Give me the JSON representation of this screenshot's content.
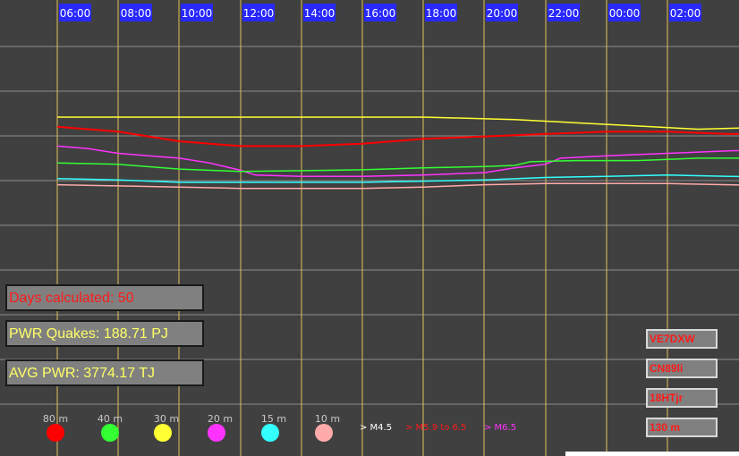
{
  "chart_data": {
    "type": "line",
    "x_ticks": [
      "06:00",
      "08:00",
      "10:00",
      "12:00",
      "14:00",
      "16:00",
      "18:00",
      "20:00",
      "22:00",
      "00:00",
      "02:00"
    ],
    "grid": true,
    "series": [
      {
        "name": "80 m",
        "color": "#ffff33",
        "values": [
          [
            0,
            3
          ],
          [
            3,
            3
          ],
          [
            6,
            3
          ],
          [
            9,
            3
          ],
          [
            12,
            3
          ],
          [
            15,
            2.9
          ],
          [
            18,
            2.7
          ],
          [
            19.5,
            2.6
          ],
          [
            21,
            2.5
          ],
          [
            24,
            2.6
          ]
        ]
      },
      {
        "name": "80 m",
        "color": "#ff0000",
        "values": [
          [
            0,
            2.6
          ],
          [
            2,
            2.4
          ],
          [
            4,
            2.0
          ],
          [
            6,
            1.8
          ],
          [
            8,
            1.8
          ],
          [
            10,
            1.9
          ],
          [
            12,
            2.1
          ],
          [
            14,
            2.2
          ],
          [
            16,
            2.3
          ],
          [
            18,
            2.4
          ],
          [
            20,
            2.4
          ],
          [
            22,
            2.3
          ],
          [
            24,
            2.3
          ]
        ]
      },
      {
        "name": "20 m",
        "color": "#ff33ff",
        "values": [
          [
            0,
            1.8
          ],
          [
            1,
            1.7
          ],
          [
            2,
            1.5
          ],
          [
            3,
            1.4
          ],
          [
            4,
            1.3
          ],
          [
            5,
            1.1
          ],
          [
            6,
            0.8
          ],
          [
            6.5,
            0.6
          ],
          [
            8,
            0.55
          ],
          [
            10,
            0.55
          ],
          [
            12,
            0.6
          ],
          [
            14,
            0.7
          ],
          [
            15,
            0.9
          ],
          [
            16,
            1.05
          ],
          [
            16.5,
            1.3
          ],
          [
            18,
            1.4
          ],
          [
            20,
            1.5
          ],
          [
            22,
            1.6
          ],
          [
            24,
            1.7
          ]
        ]
      },
      {
        "name": "40 m",
        "color": "#33ff33",
        "values": [
          [
            0,
            1.1
          ],
          [
            2,
            1.05
          ],
          [
            4,
            0.85
          ],
          [
            6,
            0.75
          ],
          [
            8,
            0.78
          ],
          [
            10,
            0.82
          ],
          [
            12,
            0.9
          ],
          [
            14,
            0.95
          ],
          [
            15,
            1.0
          ],
          [
            15.5,
            1.15
          ],
          [
            17,
            1.2
          ],
          [
            19,
            1.2
          ],
          [
            21,
            1.3
          ],
          [
            23,
            1.3
          ],
          [
            24,
            1.25
          ]
        ]
      },
      {
        "name": "15 m",
        "color": "#33ffff",
        "values": [
          [
            0,
            0.45
          ],
          [
            2,
            0.4
          ],
          [
            4,
            0.3
          ],
          [
            6,
            0.3
          ],
          [
            8,
            0.3
          ],
          [
            10,
            0.3
          ],
          [
            12,
            0.35
          ],
          [
            14,
            0.4
          ],
          [
            16,
            0.5
          ],
          [
            18,
            0.55
          ],
          [
            20,
            0.6
          ],
          [
            22,
            0.55
          ],
          [
            24,
            0.5
          ]
        ]
      },
      {
        "name": "10 m",
        "color": "#ffaaaa",
        "values": [
          [
            0,
            0.2
          ],
          [
            2,
            0.15
          ],
          [
            4,
            0.1
          ],
          [
            6,
            0.05
          ],
          [
            8,
            0.05
          ],
          [
            10,
            0.05
          ],
          [
            12,
            0.1
          ],
          [
            14,
            0.2
          ],
          [
            16,
            0.25
          ],
          [
            18,
            0.25
          ],
          [
            20,
            0.25
          ],
          [
            22,
            0.2
          ],
          [
            24,
            0.15
          ]
        ]
      }
    ],
    "annotations": [
      "Days calculated: 50",
      "PWR Quakes: 188.71 PJ",
      "AVG PWR: 3774.17 TJ"
    ]
  },
  "colors": {
    "background": "#404040",
    "grid_vertical": "#e0c05a",
    "grid_horizontal": "#8c8c8c",
    "tick_bg": "#2828ff",
    "tick_text": "#ffffff"
  },
  "info": {
    "days": "Days calculated: 50",
    "quakes": "PWR Quakes: 188.71 PJ",
    "avg": "AVG PWR: 3774.17 TJ"
  },
  "stations": [
    "VE7DXW",
    "CN89li",
    "18HTjr",
    "130 m"
  ],
  "legend": [
    {
      "label": "80 m",
      "color": "#ff0000"
    },
    {
      "label": "40 m",
      "color": "#33ff33"
    },
    {
      "label": "30 m",
      "color": "#ffff33"
    },
    {
      "label": "20 m",
      "color": "#ff33ff"
    },
    {
      "label": "15 m",
      "color": "#33ffff"
    },
    {
      "label": "10 m",
      "color": "#ffaaaa"
    }
  ],
  "magnitudes": [
    {
      "label": "> M4.5",
      "color": "#ffffff"
    },
    {
      "label": "> M5.9 to 6.5",
      "color": "#ff1a1a"
    },
    {
      "label": "> M6.5",
      "color": "#ff33ff"
    }
  ]
}
